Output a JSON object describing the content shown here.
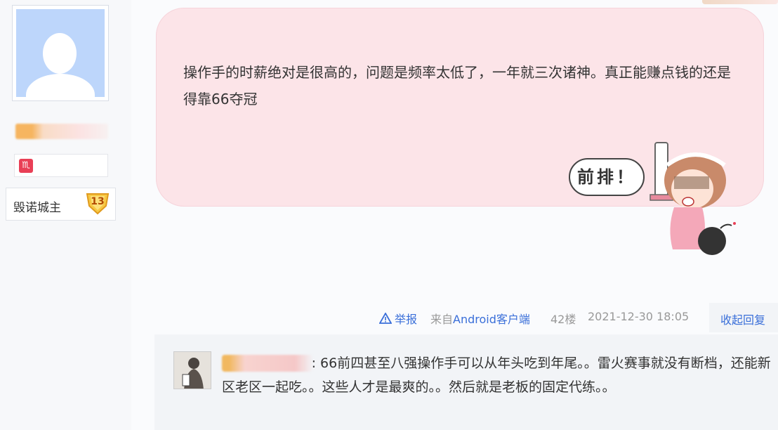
{
  "user": {
    "level_name": "毁诺城主",
    "level_number": "13",
    "medal_glyph": "♏"
  },
  "post": {
    "text": "操作手的时薪绝对是很高的，问题是频率太低了，一年就三次诸神。真正能赚点钱的还是得靠66夺冠",
    "sticker_text": "前排！"
  },
  "actions": {
    "report_label": "举报",
    "source_prefix": "来自",
    "source_app": "Android客户端",
    "floor": "42楼",
    "timestamp": "2021-12-30 18:05",
    "collapse_label": "收起回复"
  },
  "reply": {
    "colon": ":",
    "text": " 66前四甚至八强操作手可以从年头吃到年尾。。雷火赛事就没有断档，还能新区老区一起吃。。这些人才是最爽的。。然后就是老板的固定代练。。"
  },
  "colors": {
    "bubble": "#fce4e8",
    "link": "#3a6fd9",
    "avatar_bg": "#bdd6fb"
  }
}
